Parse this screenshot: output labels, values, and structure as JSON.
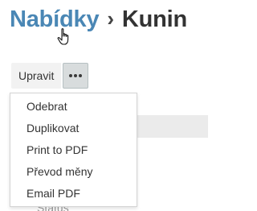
{
  "breadcrumb": {
    "parent": "Nabídky",
    "separator": "›",
    "current": "Kunin"
  },
  "toolbar": {
    "edit_label": "Upravit",
    "more_icon": "ellipsis-icon"
  },
  "menu": {
    "items": [
      {
        "label": "Odebrat"
      },
      {
        "label": "Duplikovat"
      },
      {
        "label": "Print to PDF"
      },
      {
        "label": "Převod měny"
      },
      {
        "label": "Email PDF"
      }
    ]
  },
  "background": {
    "partial_text": "Status"
  },
  "colors": {
    "link": "#4a87b5",
    "text": "#333333",
    "more_button_bg": "#d8dcdd"
  }
}
